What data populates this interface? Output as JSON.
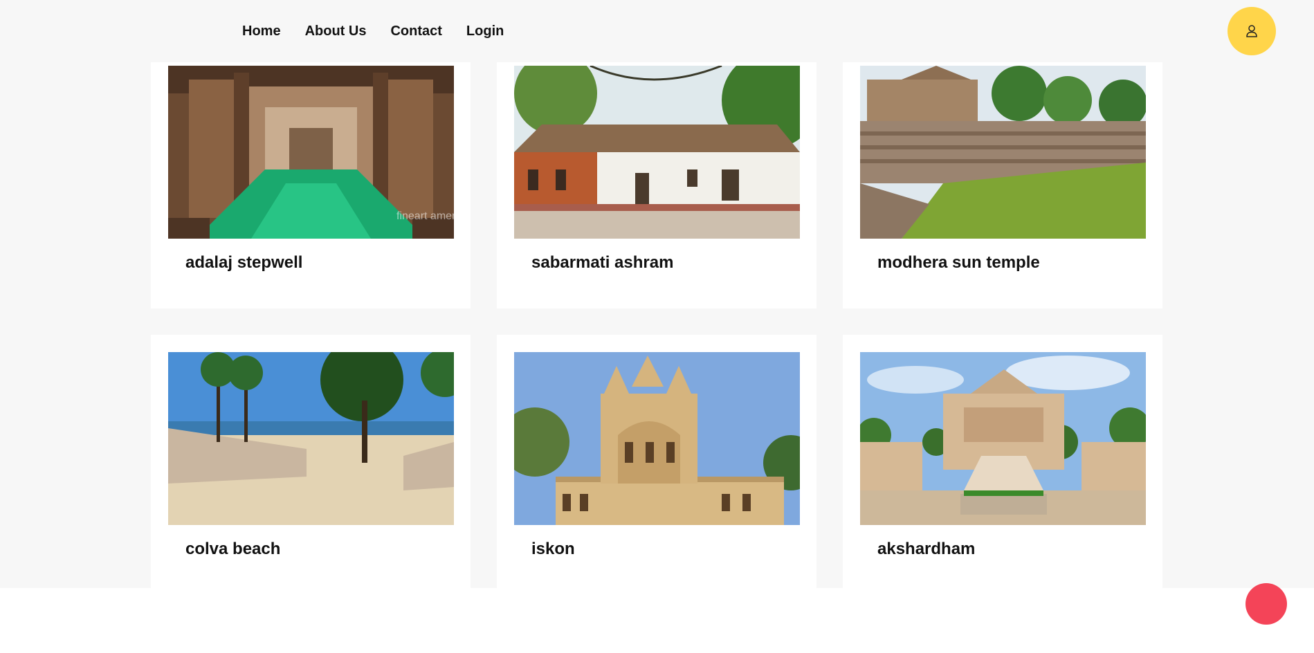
{
  "nav": {
    "items": [
      "Home",
      "About Us",
      "Contact",
      "Login"
    ]
  },
  "header": {
    "user_icon": "user-icon",
    "accent": "#ffd54a"
  },
  "cards": [
    {
      "title": "adalaj stepwell",
      "image": "stepwell-photo"
    },
    {
      "title": "sabarmati ashram",
      "image": "ashram-photo"
    },
    {
      "title": "modhera sun temple",
      "image": "sun-temple-photo"
    },
    {
      "title": "colva beach",
      "image": "beach-photo"
    },
    {
      "title": "iskon",
      "image": "iskcon-temple-photo"
    },
    {
      "title": "akshardham",
      "image": "akshardham-photo"
    }
  ],
  "watermark": "fineart america",
  "colors": {
    "background": "#f7f7f7",
    "card": "#ffffff",
    "chat": "#f44458"
  }
}
